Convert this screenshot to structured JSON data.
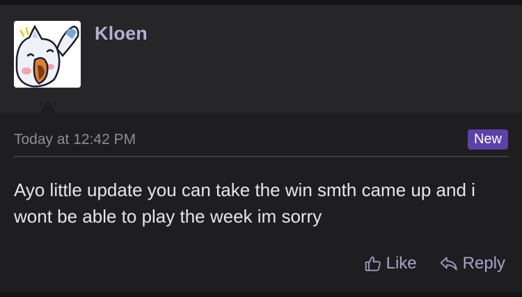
{
  "post": {
    "username": "Kloen",
    "timestamp": "Today at 12:42 PM",
    "badge": "New",
    "message": "Ayo little update you can take the win smth came up and i wont be able to play the week im sorry"
  },
  "actions": {
    "like_label": "Like",
    "reply_label": "Reply"
  },
  "icons": {
    "like": "thumbs-up-icon",
    "reply": "reply-arrow-icon"
  },
  "colors": {
    "username": "#b5b0d4",
    "badge": "#5a42a8",
    "action": "#a8a3cc"
  }
}
